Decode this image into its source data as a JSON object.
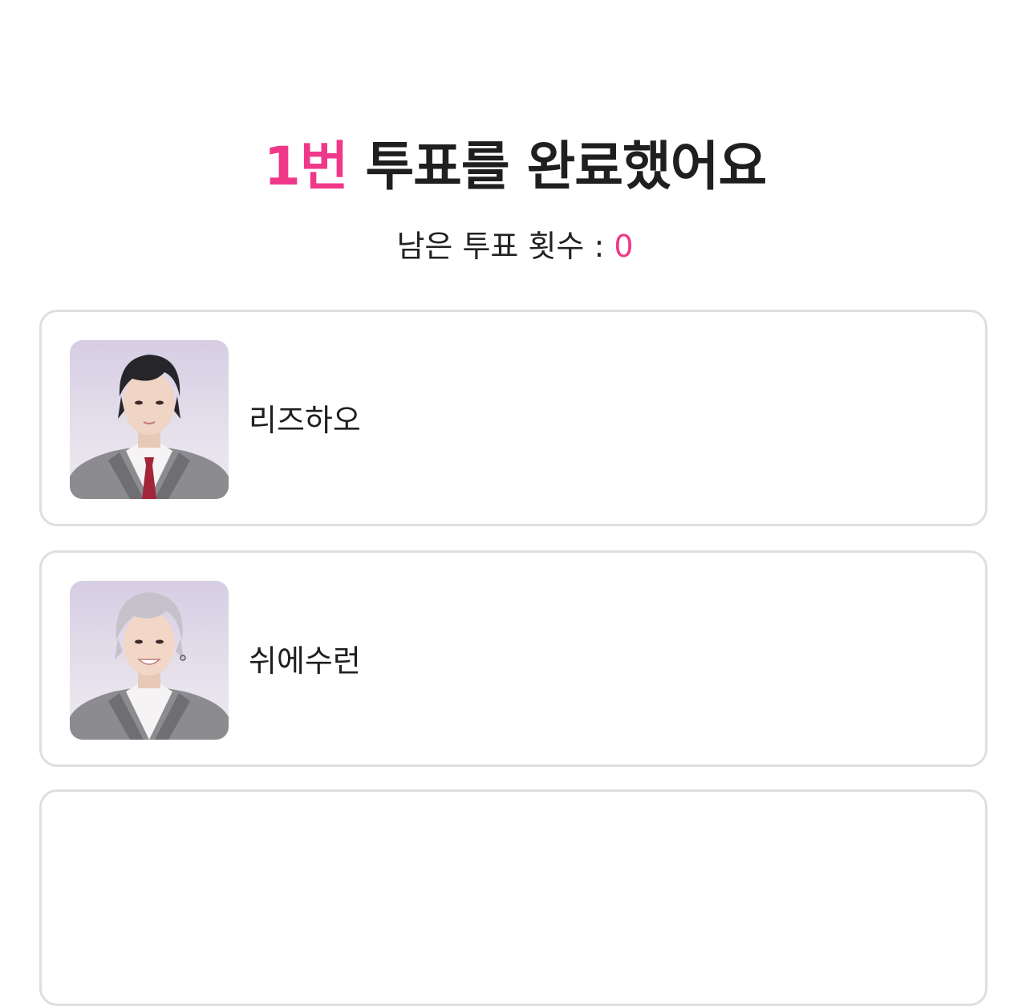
{
  "header": {
    "count_label": "1번",
    "title_rest": " 투표를 완료했어요"
  },
  "subtitle": {
    "label": "남은 투표 횟수 : ",
    "remaining": "0"
  },
  "candidates": [
    {
      "name": "리즈하오",
      "photo_icon": "portrait-dark-hair"
    },
    {
      "name": "쉬에수런",
      "photo_icon": "portrait-silver-hair"
    }
  ],
  "colors": {
    "accent": "#f0388b",
    "text": "#1f1f1f",
    "card_border": "#dedee3"
  }
}
